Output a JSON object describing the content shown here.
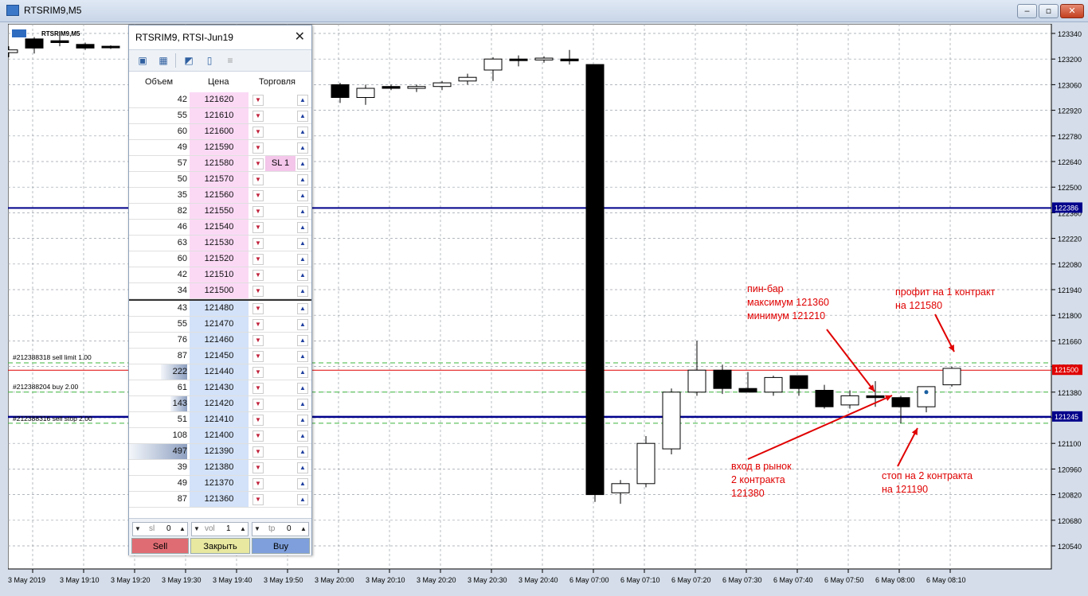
{
  "window": {
    "title": "RTSRIM9,M5"
  },
  "chart": {
    "symbol_label": "RTSRIM9,M5",
    "price_axis": [
      "123340",
      "123200",
      "123060",
      "122920",
      "122780",
      "122640",
      "122500",
      "122360",
      "122220",
      "122080",
      "121940",
      "121800",
      "121660",
      "121520",
      "121380",
      "121240",
      "121100",
      "120960",
      "120820",
      "120680",
      "120540"
    ],
    "time_axis": [
      "3 May 2019",
      "3 May 19:10",
      "3 May 19:20",
      "3 May 19:30",
      "3 May 19:40",
      "3 May 19:50",
      "3 May 20:00",
      "3 May 20:10",
      "3 May 20:20",
      "3 May 20:30",
      "3 May 20:40",
      "6 May 07:00",
      "6 May 07:10",
      "6 May 07:20",
      "6 May 07:30",
      "6 May 07:40",
      "6 May 07:50",
      "6 May 08:00",
      "6 May 08:10"
    ],
    "price_tags": [
      {
        "text": "122386",
        "color": "#00008b"
      },
      {
        "text": "121500",
        "color": "#e00000"
      },
      {
        "text": "121245",
        "color": "#00008b"
      }
    ],
    "order_labels": [
      "#212388318 sell limit 1.00",
      "#212388204 buy 2.00",
      "#212388316 sell stop 2.00"
    ],
    "annotations": {
      "pinbar": [
        "пин-бар",
        "максимум 121360",
        "минимум 121210"
      ],
      "profit": [
        "профит на 1 контракт",
        "на 121580"
      ],
      "entry": [
        "вход в рынок",
        "2 контракта",
        "121380"
      ],
      "stop": [
        "стоп на 2 контракта",
        "на 121190"
      ],
      "color": "#e00000"
    }
  },
  "depth_of_market": {
    "title": "RTSRIM9, RTSI-Jun19",
    "columns": [
      "Объем",
      "Цена",
      "Торговля"
    ],
    "rows": [
      {
        "vol": "42",
        "price": "121620",
        "side": "ask",
        "sl": ""
      },
      {
        "vol": "55",
        "price": "121610",
        "side": "ask",
        "sl": ""
      },
      {
        "vol": "60",
        "price": "121600",
        "side": "ask",
        "sl": ""
      },
      {
        "vol": "49",
        "price": "121590",
        "side": "ask",
        "sl": ""
      },
      {
        "vol": "57",
        "price": "121580",
        "side": "ask",
        "sl": "SL 1"
      },
      {
        "vol": "50",
        "price": "121570",
        "side": "ask",
        "sl": ""
      },
      {
        "vol": "35",
        "price": "121560",
        "side": "ask",
        "sl": ""
      },
      {
        "vol": "82",
        "price": "121550",
        "side": "ask",
        "sl": ""
      },
      {
        "vol": "46",
        "price": "121540",
        "side": "ask",
        "sl": ""
      },
      {
        "vol": "63",
        "price": "121530",
        "side": "ask",
        "sl": ""
      },
      {
        "vol": "60",
        "price": "121520",
        "side": "ask",
        "sl": ""
      },
      {
        "vol": "42",
        "price": "121510",
        "side": "ask",
        "sl": ""
      },
      {
        "vol": "34",
        "price": "121500",
        "side": "ask",
        "sl": ""
      },
      {
        "vol": "43",
        "price": "121480",
        "side": "bid",
        "sl": ""
      },
      {
        "vol": "55",
        "price": "121470",
        "side": "bid",
        "sl": ""
      },
      {
        "vol": "76",
        "price": "121460",
        "side": "bid",
        "sl": ""
      },
      {
        "vol": "87",
        "price": "121450",
        "side": "bid",
        "sl": ""
      },
      {
        "vol": "222",
        "price": "121440",
        "side": "bid",
        "sl": ""
      },
      {
        "vol": "61",
        "price": "121430",
        "side": "bid",
        "sl": ""
      },
      {
        "vol": "143",
        "price": "121420",
        "side": "bid",
        "sl": ""
      },
      {
        "vol": "51",
        "price": "121410",
        "side": "bid",
        "sl": ""
      },
      {
        "vol": "108",
        "price": "121400",
        "side": "bid",
        "sl": ""
      },
      {
        "vol": "497",
        "price": "121390",
        "side": "bid",
        "sl": ""
      },
      {
        "vol": "39",
        "price": "121380",
        "side": "bid",
        "sl": ""
      },
      {
        "vol": "49",
        "price": "121370",
        "side": "bid",
        "sl": ""
      },
      {
        "vol": "87",
        "price": "121360",
        "side": "bid",
        "sl": ""
      }
    ],
    "footer": {
      "sl_label": "sl",
      "sl_value": "0",
      "vol_label": "vol",
      "vol_value": "1",
      "tp_label": "tp",
      "tp_value": "0",
      "sell": "Sell",
      "close": "Закрыть",
      "buy": "Buy"
    },
    "colors": {
      "ask": "#fbd9f5",
      "bid": "#d3e2f8"
    }
  }
}
